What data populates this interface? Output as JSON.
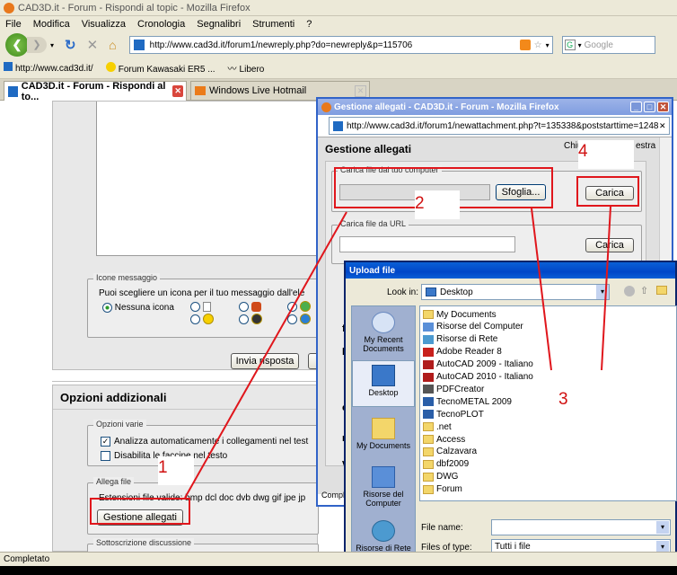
{
  "browser": {
    "window_title": "CAD3D.it - Forum - Rispondi al topic - Mozilla Firefox",
    "menu": [
      "File",
      "Modifica",
      "Visualizza",
      "Cronologia",
      "Segnalibri",
      "Strumenti",
      "?"
    ],
    "url": "http://www.cad3d.it/forum1/newreply.php?do=newreply&p=115706",
    "search_placeholder": "Google",
    "bookmarks": [
      "http://www.cad3d.it/",
      "Forum Kawasaki ER5 ...",
      "Libero"
    ],
    "tabs": [
      "CAD3D.it - Forum - Rispondi al to...",
      "Windows Live Hotmail"
    ],
    "status": "Completato"
  },
  "forum": {
    "icons_legend": "Icone messaggio",
    "icons_text": "Puoi scegliere un icona per il tuo messaggio dall'ele",
    "no_icon": "Nessuna icona",
    "submit_button": "Invia risposta",
    "options_title": "Opzioni addizionali",
    "misc_legend": "Opzioni varie",
    "opt1": "Analizza automaticamente i collegamenti nel test",
    "opt2": "Disabilita le faccine nel testo",
    "attach_legend": "Allega file",
    "attach_text": "Estensioni file valide: bmp dcl doc dvb dwg gif jpe jp",
    "attach_button": "Gestione allegati",
    "subscribe_legend": "Sottoscrizione discussione",
    "left_letters": [
      "f",
      "b",
      "c",
      "m",
      "v"
    ]
  },
  "popup": {
    "window_title": "Gestione allegati - CAD3D.it - Forum - Mozilla Firefox",
    "url": "http://www.cad3d.it/forum1/newattachment.php?t=135338&poststarttime=12481",
    "heading": "Gestione allegati",
    "close_text_left": "Chiu",
    "close_text_right": "estra",
    "upload_legend": "Carica file dal tuo computer",
    "browse_button": "Sfoglia...",
    "upload_button": "Carica",
    "url_legend": "Carica file da URL",
    "url_upload_button": "Carica",
    "status": "Comple"
  },
  "upload_dialog": {
    "title": "Upload file",
    "look_in_label": "Look in:",
    "look_in_value": "Desktop",
    "places": [
      "My Recent Documents",
      "Desktop",
      "My Documents",
      "Risorse del Computer",
      "Risorse di Rete"
    ],
    "files": [
      {
        "name": "My Documents",
        "icon": "folder-docs-icon"
      },
      {
        "name": "Risorse del Computer",
        "icon": "computer-icon"
      },
      {
        "name": "Risorse di Rete",
        "icon": "network-icon"
      },
      {
        "name": "Adobe Reader 8",
        "icon": "adobe-icon"
      },
      {
        "name": "AutoCAD 2009 - Italiano",
        "icon": "autocad-icon"
      },
      {
        "name": "AutoCAD 2010 - Italiano",
        "icon": "autocad-icon"
      },
      {
        "name": "PDFCreator",
        "icon": "pdf-icon"
      },
      {
        "name": "TecnoMETAL 2009",
        "icon": "app-icon"
      },
      {
        "name": "TecnoPLOT",
        "icon": "app-icon"
      },
      {
        "name": ".net",
        "icon": "folder-icon"
      },
      {
        "name": "Access",
        "icon": "folder-icon"
      },
      {
        "name": "Calzavara",
        "icon": "folder-icon"
      },
      {
        "name": "dbf2009",
        "icon": "folder-icon"
      },
      {
        "name": "DWG",
        "icon": "folder-icon"
      },
      {
        "name": "Forum",
        "icon": "folder-icon"
      }
    ],
    "file_name_label": "File name:",
    "file_type_label": "Files of type:",
    "file_type_value": "Tutti i file"
  },
  "annotations": {
    "n1": "1",
    "n2": "2",
    "n3": "3",
    "n4": "4"
  },
  "colors": {
    "annotation": "#e0161c",
    "xp_blue": "#0a246a"
  }
}
